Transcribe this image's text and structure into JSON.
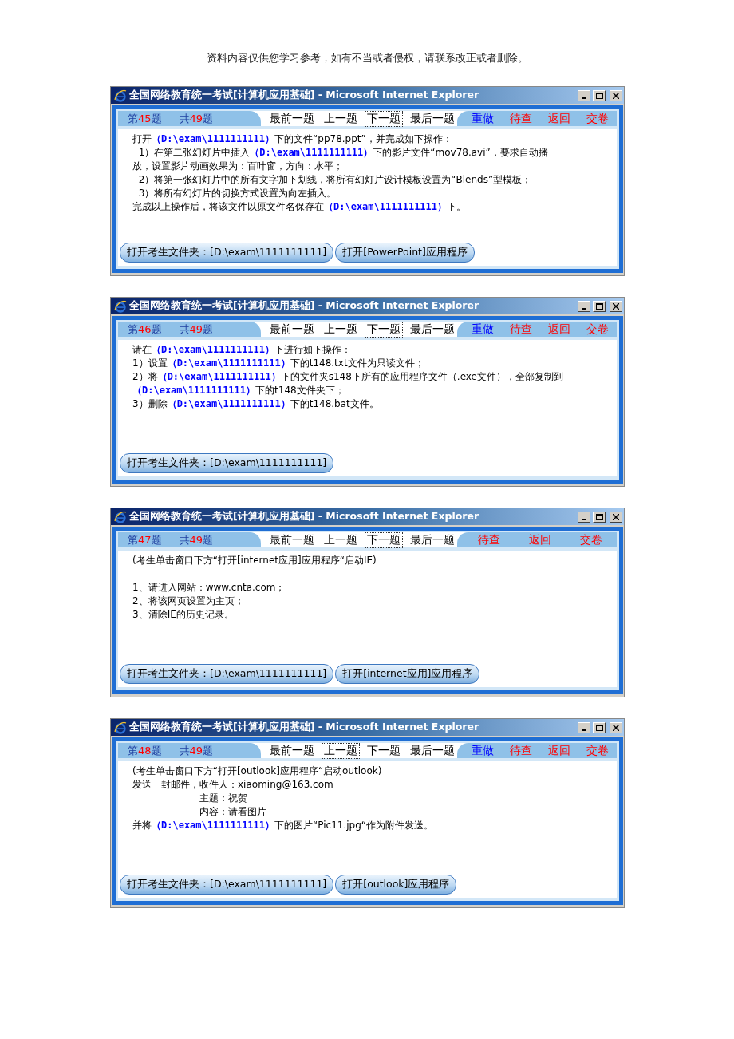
{
  "header": "资料内容仅供您学习参考，如有不当或者侵权，请联系改正或者删除。",
  "windows": [
    {
      "title": "全国网络教育统一考试[计算机应用基础] - Microsoft Internet Explorer",
      "counter": {
        "prefix": "第",
        "number": "45",
        "suffix": "题"
      },
      "total": {
        "prefix": "共",
        "number": "49",
        "suffix": "题"
      },
      "nav": [
        {
          "label": "最前一题",
          "selected": false
        },
        {
          "label": "上一题",
          "selected": false
        },
        {
          "label": "下一题",
          "selected": true
        },
        {
          "label": "最后一题",
          "selected": false
        }
      ],
      "actions": [
        {
          "label": "重做",
          "kind": "normal"
        },
        {
          "label": "待查",
          "kind": "warning"
        },
        {
          "label": "返回",
          "kind": "warning"
        },
        {
          "label": "交卷",
          "kind": "warning"
        }
      ],
      "lines": [
        {
          "segments": [
            {
              "kind": "text",
              "text": "打开"
            },
            {
              "kind": "path",
              "text": "（D:\\exam\\1111111111）"
            },
            {
              "kind": "text",
              "text": "下的文件“pp78.ppt”，并完成如下操作："
            }
          ]
        },
        {
          "segments": [
            {
              "kind": "text",
              "text": "  1）在第二张幻灯片中插入"
            },
            {
              "kind": "path",
              "text": "（D:\\exam\\1111111111）"
            },
            {
              "kind": "text",
              "text": "下的影片文件“mov78.avi”，要求自动播"
            }
          ]
        },
        {
          "segments": [
            {
              "kind": "text",
              "text": "放，设置影片动画效果为：百叶窗，方向：水平；"
            }
          ]
        },
        {
          "segments": [
            {
              "kind": "text",
              "text": "  2）将第一张幻灯片中的所有文字加下划线，将所有幻灯片设计模板设置为“Blends”型模板；"
            }
          ]
        },
        {
          "segments": [
            {
              "kind": "text",
              "text": "  3）将所有幻灯片的切换方式设置为向左插入。"
            }
          ]
        },
        {
          "segments": [
            {
              "kind": "text",
              "text": "完成以上操作后，将该文件以原文件名保存在"
            },
            {
              "kind": "path",
              "text": "（D:\\exam\\1111111111）"
            },
            {
              "kind": "text",
              "text": "下。"
            }
          ]
        }
      ],
      "buttons": [
        "打开考生文件夹：[D:\\exam\\1111111111]",
        "打开[PowerPoint]应用程序"
      ]
    },
    {
      "title": "全国网络教育统一考试[计算机应用基础] - Microsoft Internet Explorer",
      "counter": {
        "prefix": "第",
        "number": "46",
        "suffix": "题"
      },
      "total": {
        "prefix": "共",
        "number": "49",
        "suffix": "题"
      },
      "nav": [
        {
          "label": "最前一题",
          "selected": false
        },
        {
          "label": "上一题",
          "selected": false
        },
        {
          "label": "下一题",
          "selected": true
        },
        {
          "label": "最后一题",
          "selected": false
        }
      ],
      "actions": [
        {
          "label": "重做",
          "kind": "normal"
        },
        {
          "label": "待查",
          "kind": "warning"
        },
        {
          "label": "返回",
          "kind": "warning"
        },
        {
          "label": "交卷",
          "kind": "warning"
        }
      ],
      "lines": [
        {
          "segments": [
            {
              "kind": "text",
              "text": "请在"
            },
            {
              "kind": "path",
              "text": "（D:\\exam\\1111111111）"
            },
            {
              "kind": "text",
              "text": "下进行如下操作："
            }
          ]
        },
        {
          "segments": [
            {
              "kind": "text",
              "text": "1）设置"
            },
            {
              "kind": "path",
              "text": "（D:\\exam\\1111111111）"
            },
            {
              "kind": "text",
              "text": "下的t148.txt文件为只读文件；"
            }
          ]
        },
        {
          "segments": [
            {
              "kind": "text",
              "text": "2）将"
            },
            {
              "kind": "path",
              "text": "（D:\\exam\\1111111111）"
            },
            {
              "kind": "text",
              "text": "下的文件夹s148下所有的应用程序文件（.exe文件），全部复制到"
            }
          ]
        },
        {
          "segments": [
            {
              "kind": "path",
              "text": "（D:\\exam\\1111111111）"
            },
            {
              "kind": "text",
              "text": "下的t148文件夹下；"
            }
          ]
        },
        {
          "segments": [
            {
              "kind": "text",
              "text": "3）删除"
            },
            {
              "kind": "path",
              "text": "（D:\\exam\\1111111111）"
            },
            {
              "kind": "text",
              "text": "下的t148.bat文件。"
            }
          ]
        }
      ],
      "buttons": [
        "打开考生文件夹：[D:\\exam\\1111111111]"
      ]
    },
    {
      "title": "全国网络教育统一考试[计算机应用基础] - Microsoft Internet Explorer",
      "counter": {
        "prefix": "第",
        "number": "47",
        "suffix": "题"
      },
      "total": {
        "prefix": "共",
        "number": "49",
        "suffix": "题"
      },
      "nav": [
        {
          "label": "最前一题",
          "selected": false
        },
        {
          "label": "上一题",
          "selected": false
        },
        {
          "label": "下一题",
          "selected": true
        },
        {
          "label": "最后一题",
          "selected": false
        }
      ],
      "actions": [
        {
          "label": "待查",
          "kind": "warning"
        },
        {
          "label": "返回",
          "kind": "warning"
        },
        {
          "label": "交卷",
          "kind": "warning"
        }
      ],
      "note": "(考生单击窗口下方“打开[internet应用]应用程序“启动IE)",
      "lines": [
        {
          "segments": [
            {
              "kind": "text",
              "text": "1、请进入网站：www.cnta.com；"
            }
          ]
        },
        {
          "segments": [
            {
              "kind": "text",
              "text": "2、将该网页设置为主页；"
            }
          ]
        },
        {
          "segments": [
            {
              "kind": "text",
              "text": "3、清除IE的历史记录。"
            }
          ]
        }
      ],
      "buttons": [
        "打开考生文件夹：[D:\\exam\\1111111111]",
        "打开[internet应用]应用程序"
      ]
    },
    {
      "title": "全国网络教育统一考试[计算机应用基础] - Microsoft Internet Explorer",
      "counter": {
        "prefix": "第",
        "number": "48",
        "suffix": "题"
      },
      "total": {
        "prefix": "共",
        "number": "49",
        "suffix": "题"
      },
      "nav": [
        {
          "label": "最前一题",
          "selected": false
        },
        {
          "label": "上一题",
          "selected": true
        },
        {
          "label": "下一题",
          "selected": false
        },
        {
          "label": "最后一题",
          "selected": false
        }
      ],
      "actions": [
        {
          "label": "重做",
          "kind": "normal"
        },
        {
          "label": "待查",
          "kind": "warning"
        },
        {
          "label": "返回",
          "kind": "warning"
        },
        {
          "label": "交卷",
          "kind": "warning"
        }
      ],
      "lines": [
        {
          "segments": [
            {
              "kind": "text",
              "text": "(考生单击窗口下方“打开[outlook]应用程序“启动outlook)"
            }
          ]
        },
        {
          "segments": [
            {
              "kind": "text",
              "text": "发送一封邮件，收件人：xiaoming@163.com"
            }
          ]
        },
        {
          "segments": [
            {
              "kind": "text",
              "text": "　　　　　　　主题：祝贺"
            }
          ]
        },
        {
          "segments": [
            {
              "kind": "text",
              "text": "　　　　　　　内容：请看图片"
            }
          ]
        },
        {
          "segments": [
            {
              "kind": "text",
              "text": "并将"
            },
            {
              "kind": "path",
              "text": "（D:\\exam\\1111111111）"
            },
            {
              "kind": "text",
              "text": "下的图片“Pic11.jpg“作为附件发送。"
            }
          ]
        }
      ],
      "buttons": [
        "打开考生文件夹：[D:\\exam\\1111111111]",
        "打开[outlook]应用程序"
      ]
    }
  ]
}
